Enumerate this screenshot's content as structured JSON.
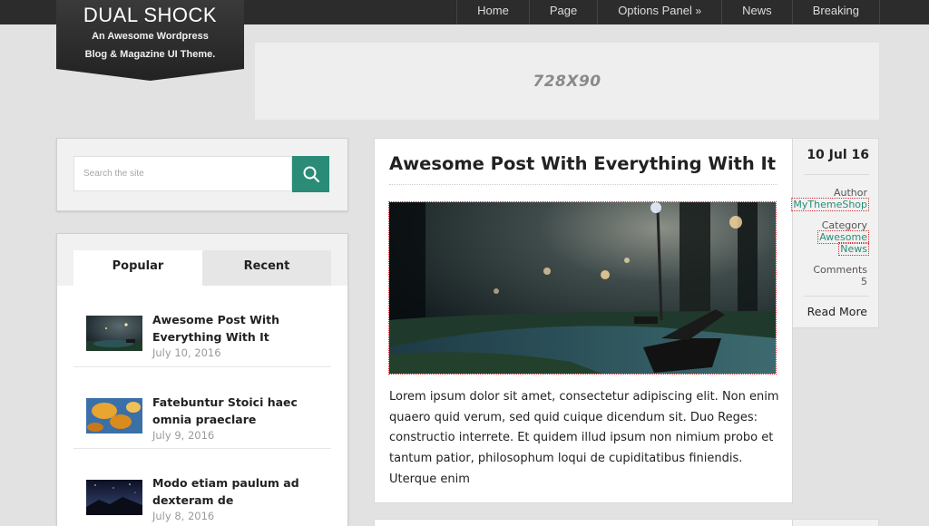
{
  "nav": {
    "items": [
      "Home",
      "Page",
      "Options Panel",
      "News",
      "Breaking"
    ],
    "options_arrow": "»"
  },
  "logo": {
    "title": "DUAL SHOCK",
    "subtitle_line1": "An Awesome Wordpress",
    "subtitle_line2": "Blog & Magazine UI Theme."
  },
  "ad": {
    "label": "728X90"
  },
  "search": {
    "placeholder": "Search the site",
    "value": ""
  },
  "tabs": {
    "items": [
      "Popular",
      "Recent"
    ],
    "active": "Popular",
    "posts": [
      {
        "title": "Awesome Post With Everything With It",
        "date": "July 10, 2016",
        "thumb": "night-park-bench"
      },
      {
        "title": "Fatebuntur Stoici haec omnia praeclare",
        "date": "July 9, 2016",
        "thumb": "autumn-leaves"
      },
      {
        "title": "Modo etiam paulum ad dexteram de",
        "date": "July 8, 2016",
        "thumb": "starry-night"
      }
    ]
  },
  "post": {
    "title": "Awesome Post With Everything With It",
    "excerpt": "Lorem ipsum dolor sit amet, consectetur adipiscing elit. Non enim quaero quid verum, sed quid cuique dicendum sit. Duo Reges: constructio interrete. Et quidem illud ipsum non nimium probo et tantum patior, philosophum loqui de cupiditatibus finiendis. Uterque enim",
    "image": "night-park-bench"
  },
  "meta": {
    "date": "10 Jul 16",
    "author_label": "Author",
    "author": "MyThemeShop",
    "category_label": "Category",
    "categories": [
      "Awesome",
      "News"
    ],
    "comments_label": "Comments",
    "comments": "5",
    "read_more": "Read More"
  },
  "colors": {
    "accent": "#2a8b76",
    "topbar": "#2c2c2c",
    "background": "#e2e2e2"
  }
}
